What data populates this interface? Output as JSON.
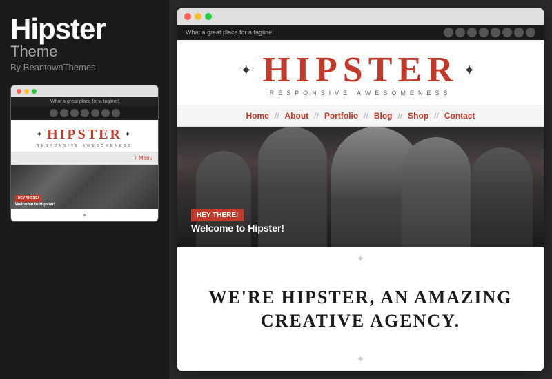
{
  "leftPanel": {
    "title": "Hipster",
    "subtitle": "Theme",
    "author": "By BeantownThemes"
  },
  "miniBrowser": {
    "tagline": "What a great place for a tagline!",
    "logoText": "HIPSTER",
    "logoSub": "RESPONSIVE AWESOMENESS",
    "menuLabel": "+ Menu",
    "heyBadge": "HEY THERE!",
    "welcomeText": "Welcome to Hipster!"
  },
  "bigBrowser": {
    "tagline": "What a great place for a tagline!",
    "logoText": "HIPSTER",
    "logoSub": "RESPONSIVE AWESOMENESS",
    "nav": [
      "Home",
      "About",
      "Portfolio",
      "Blog",
      "Shop",
      "Contact"
    ],
    "navSep": "//",
    "heyBadge": "HEY THERE!",
    "welcomeText": "Welcome to Hipster!",
    "headline1": "WE'RE HIPSTER, AN AMAZING",
    "headline2": "CREATIVE AGENCY."
  },
  "dots": {
    "red": "#ff5f57",
    "yellow": "#febc2e",
    "green": "#28c840"
  }
}
